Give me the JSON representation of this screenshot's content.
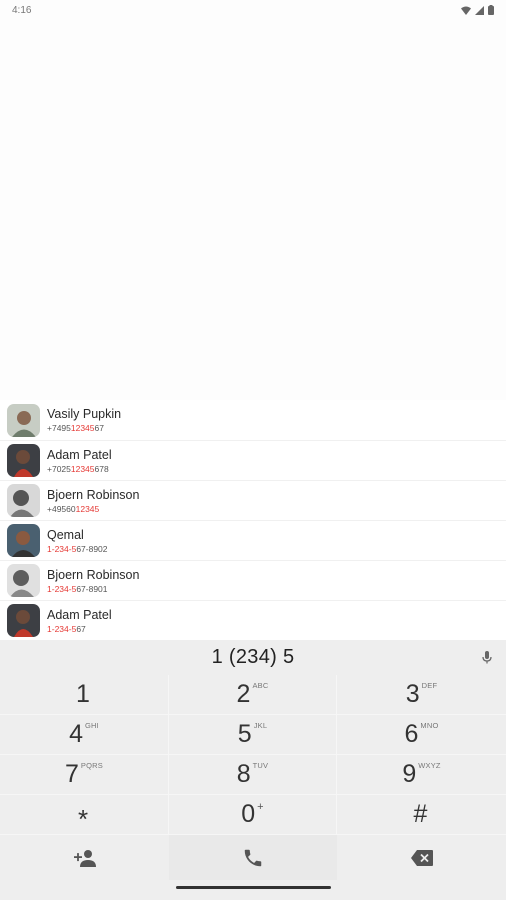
{
  "status_bar": {
    "time": "4:16"
  },
  "contacts": [
    {
      "name": "Vasily Pupkin",
      "number_pre": "+7495",
      "number_hl": "12345",
      "number_post": "67",
      "avatar_color": "#7a8a7c"
    },
    {
      "name": "Adam Patel",
      "number_pre": "+7025",
      "number_hl": "12345",
      "number_post": "678",
      "avatar_color": "#5a3e32"
    },
    {
      "name": "Bjoern Robinson",
      "number_pre": "+49560",
      "number_hl": "12345",
      "number_post": "",
      "avatar_color": "#9a9a9a"
    },
    {
      "name": "Qemal",
      "number_pre": "1-",
      "number_hl": "234-5",
      "number_post": "67-8902",
      "avatar_color": "#6b4a3a"
    },
    {
      "name": "Bjoern Robinson",
      "number_pre": "1-",
      "number_hl": "234-5",
      "number_post": "67-8901",
      "avatar_color": "#8f8f8f"
    },
    {
      "name": "Adam Patel",
      "number_pre": "1-",
      "number_hl": "234-5",
      "number_post": "67",
      "avatar_color": "#5a3e32"
    }
  ],
  "dialer": {
    "display_number": "1 (234) 5",
    "keys": [
      {
        "digit": "1",
        "letters": ""
      },
      {
        "digit": "2",
        "letters": "ABC"
      },
      {
        "digit": "3",
        "letters": "DEF"
      },
      {
        "digit": "4",
        "letters": "GHI"
      },
      {
        "digit": "5",
        "letters": "JKL"
      },
      {
        "digit": "6",
        "letters": "MNO"
      },
      {
        "digit": "7",
        "letters": "PQRS"
      },
      {
        "digit": "8",
        "letters": "TUV"
      },
      {
        "digit": "9",
        "letters": "WXYZ"
      },
      {
        "digit": "*",
        "letters": ""
      },
      {
        "digit": "0",
        "letters": "+"
      },
      {
        "digit": "#",
        "letters": ""
      }
    ],
    "actions": {
      "left_icon": "add-contact-icon",
      "center_icon": "call-icon",
      "right_icon": "backspace-icon"
    }
  },
  "colors": {
    "highlight": "#e53935",
    "dialer_bg": "#eeeeee"
  }
}
